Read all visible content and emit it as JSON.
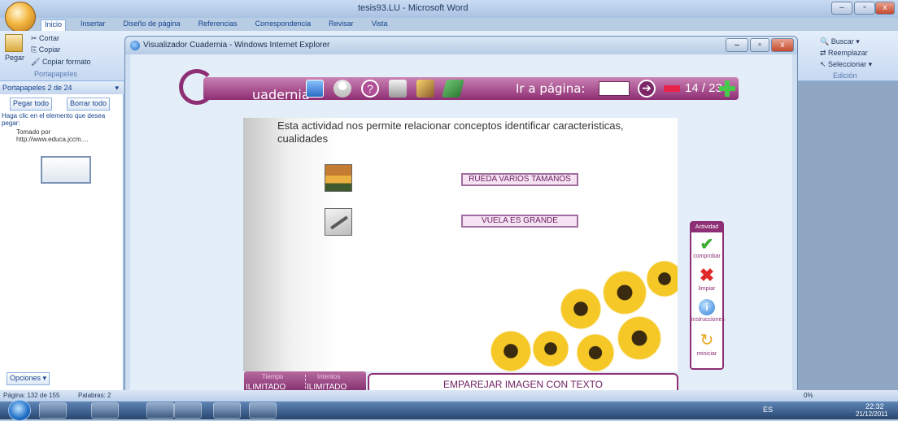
{
  "word": {
    "title": "tesis93.LU - Microsoft Word",
    "tabs": [
      "Inicio",
      "Insertar",
      "Diseño de página",
      "Referencias",
      "Correspondencia",
      "Revisar",
      "Vista"
    ],
    "clipboard_group": {
      "paste": "Pegar",
      "cut": "Cortar",
      "copy": "Copiar",
      "copy_format": "Copiar formato",
      "label": "Portapapeles"
    },
    "edit_group": {
      "find": "Buscar",
      "replace": "Reemplazar",
      "select": "Seleccionar",
      "label": "Edición"
    },
    "pane": {
      "title": "Portapapeles 2 de 24",
      "paste_all": "Pegar todo",
      "clear_all": "Borrar todo",
      "instruction": "Haga clic en el elemento que desea pegar:",
      "item1_line1": "Tomado por",
      "item1_line2": "http://www.educa.jccm....",
      "options": "Opciones"
    },
    "status": {
      "page": "Página: 132 de 155",
      "words": "Palabras: 2",
      "zoom": "0%"
    }
  },
  "ie": {
    "title": "Visualizador Cuadernia - Windows Internet Explorer"
  },
  "cuadernia": {
    "logo_letter": "C",
    "logo_text": "uadernia",
    "goto_label": "Ir a página:",
    "page_count": "14 / 23",
    "instruction": "Esta actividad nos permite relacionar conceptos  identificar caracteristicas, cualidades",
    "label1": "RUEDA  VARIOS TAMAÑOS",
    "label2": "VUELA  ES GRANDE",
    "activity": {
      "header": "Actividad",
      "check": "comprobar",
      "clear": "limpiar",
      "instructions": "instrucciones",
      "restart": "reiniciar"
    },
    "time_label": "Tiempo",
    "tries_label": "Intentos",
    "time_value": "ILIMITADO",
    "tries_value": "ILIMITADO",
    "activity_title": "EMPAREJAR IMAGEN CON TEXTO"
  },
  "taskbar": {
    "lang": "ES",
    "time": "22:32",
    "date": "21/12/2011"
  }
}
